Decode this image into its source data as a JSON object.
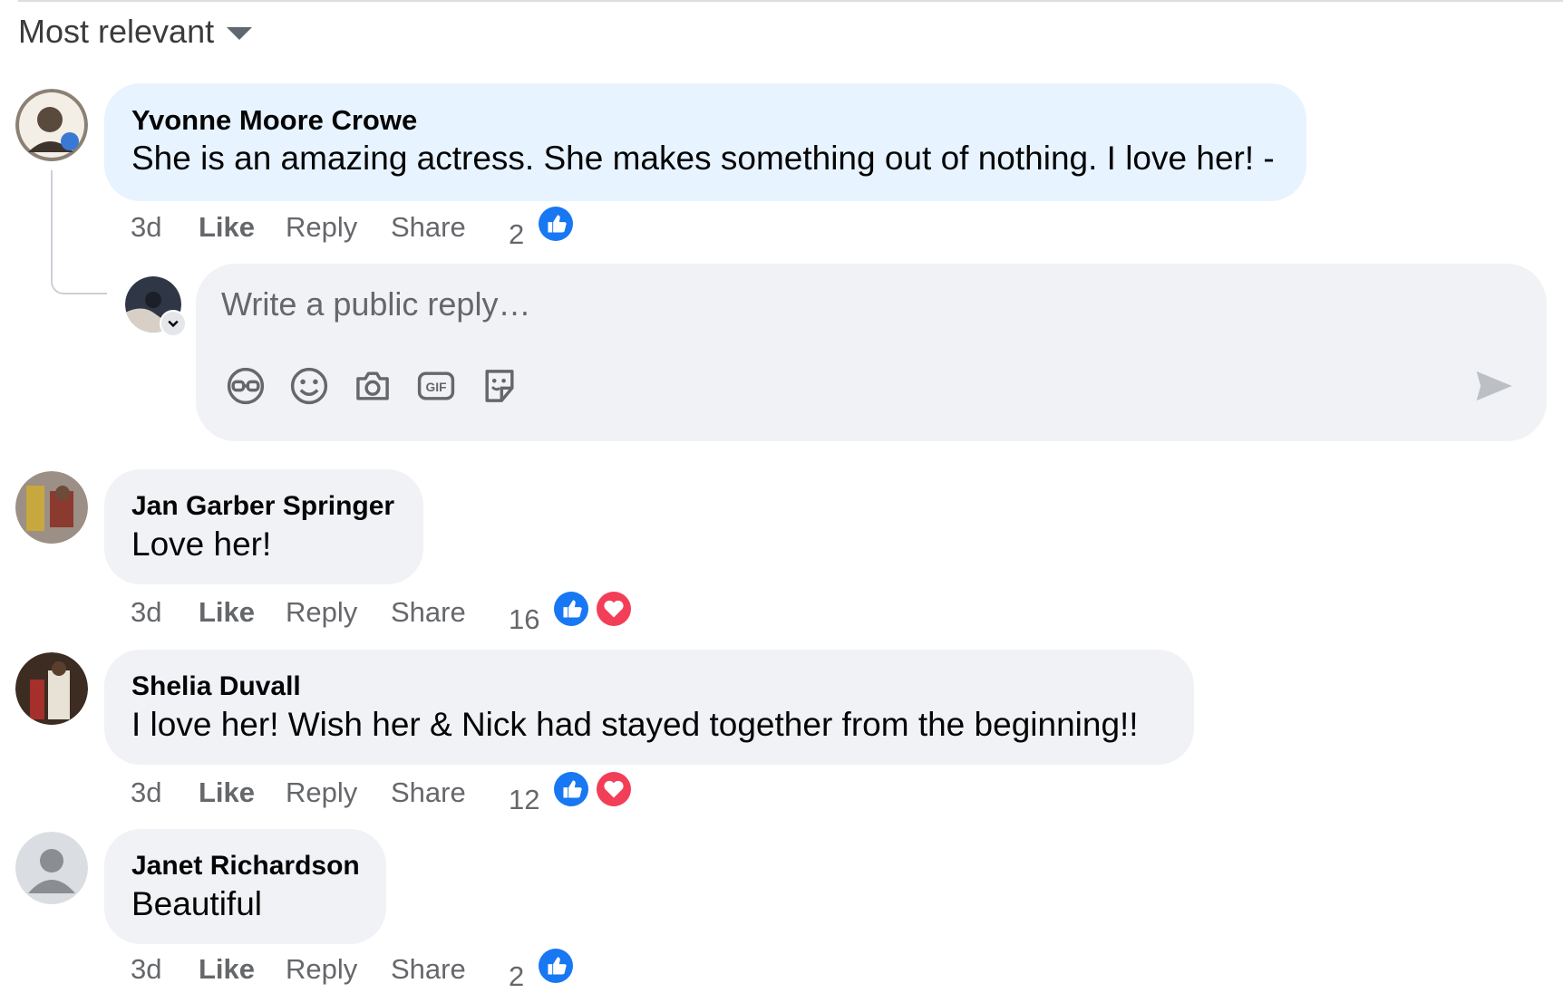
{
  "sort": {
    "label": "Most relevant"
  },
  "reply_box": {
    "placeholder": "Write a public reply…"
  },
  "comments": [
    {
      "author": "Yvonne Moore Crowe",
      "text": "She is an amazing actress. She makes something out of nothing. I love her! -",
      "time": "3d",
      "like": "Like",
      "reply": "Reply",
      "share": "Share",
      "reactions": "2",
      "reaction_types": [
        "like"
      ]
    },
    {
      "author": "Jan Garber Springer",
      "text": "Love her!",
      "time": "3d",
      "like": "Like",
      "reply": "Reply",
      "share": "Share",
      "reactions": "16",
      "reaction_types": [
        "like",
        "love"
      ]
    },
    {
      "author": "Shelia Duvall",
      "text": "I love her! Wish her & Nick had stayed together from the beginning!!",
      "time": "3d",
      "like": "Like",
      "reply": "Reply",
      "share": "Share",
      "reactions": "12",
      "reaction_types": [
        "like",
        "love"
      ]
    },
    {
      "author": "Janet Richardson",
      "text": "Beautiful",
      "time": "3d",
      "like": "Like",
      "reply": "Reply",
      "share": "Share",
      "reactions": "2",
      "reaction_types": [
        "like"
      ]
    }
  ],
  "icons": {
    "composer_tools": [
      "avatar-sticker-icon",
      "emoji-icon",
      "camera-icon",
      "gif-icon",
      "sticker-icon"
    ],
    "send": "send-icon",
    "reactions": [
      "like-reaction-icon",
      "love-reaction-icon"
    ]
  },
  "colors": {
    "like_blue": "#1877f2",
    "love_red": "#f33e58",
    "bubble": "#f0f2f5",
    "bubble_highlight": "#e7f3ff",
    "meta_text": "#65676b"
  }
}
